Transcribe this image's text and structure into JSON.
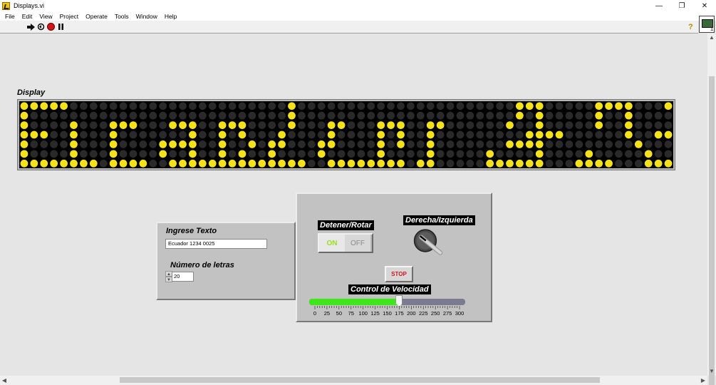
{
  "window": {
    "title": "Displays.vi",
    "minimize_glyph": "—",
    "restore_glyph": "❐",
    "close_glyph": "✕"
  },
  "menu": [
    "File",
    "Edit",
    "View",
    "Project",
    "Operate",
    "Tools",
    "Window",
    "Help"
  ],
  "toolbar": {
    "icons": [
      "run-arrow-icon",
      "run-continuously-icon",
      "abort-icon",
      "pause-icon"
    ],
    "help_icon": "help-icon"
  },
  "display": {
    "label": "Display",
    "led_color": "#f5e21a",
    "led_off_color": "#2a2a2a",
    "rows": 7,
    "cols": 66,
    "pattern": [
      "11111000000000000000000000010000000000000000000000111000001111000111",
      "10000000000000000000000000010000000000000000000000101000001001000001",
      "10000100011100011100111000010001100011100110000001001000001001000010",
      "11100100010000000100101000100001000010100100000000011110000001001110",
      "10000100010000111100100101100011000010100100000001111000000000100001",
      "10000100010000100100101001000010000010000100000100001000010000010001",
      "11111111011110011111111111111001111111101100000111111000111100011111"
    ]
  },
  "left_panel": {
    "text_label": "Ingrese Texto",
    "text_value": "Ecuador 1234 0025",
    "count_label": "Número de letras",
    "count_value": "20",
    "stepper_up": "▲",
    "stepper_down": "▼"
  },
  "right_panel": {
    "toggle_label": "Detener/Rotar",
    "toggle_on": "ON",
    "toggle_off": "OFF",
    "knob_label": "Derecha/Izquierda",
    "stop_label": "STOP",
    "slider_label": "Control de Velocidad",
    "slider_value": 175,
    "slider_min": 0,
    "slider_max": 300,
    "slider_ticks": [
      "0",
      "25",
      "50",
      "75",
      "100",
      "125",
      "150",
      "175",
      "200",
      "225",
      "250",
      "275",
      "300"
    ],
    "slider_fill_color": "#3ee61a"
  },
  "scroll": {
    "up": "▲",
    "down": "▼",
    "left": "◀",
    "right": "▶"
  }
}
